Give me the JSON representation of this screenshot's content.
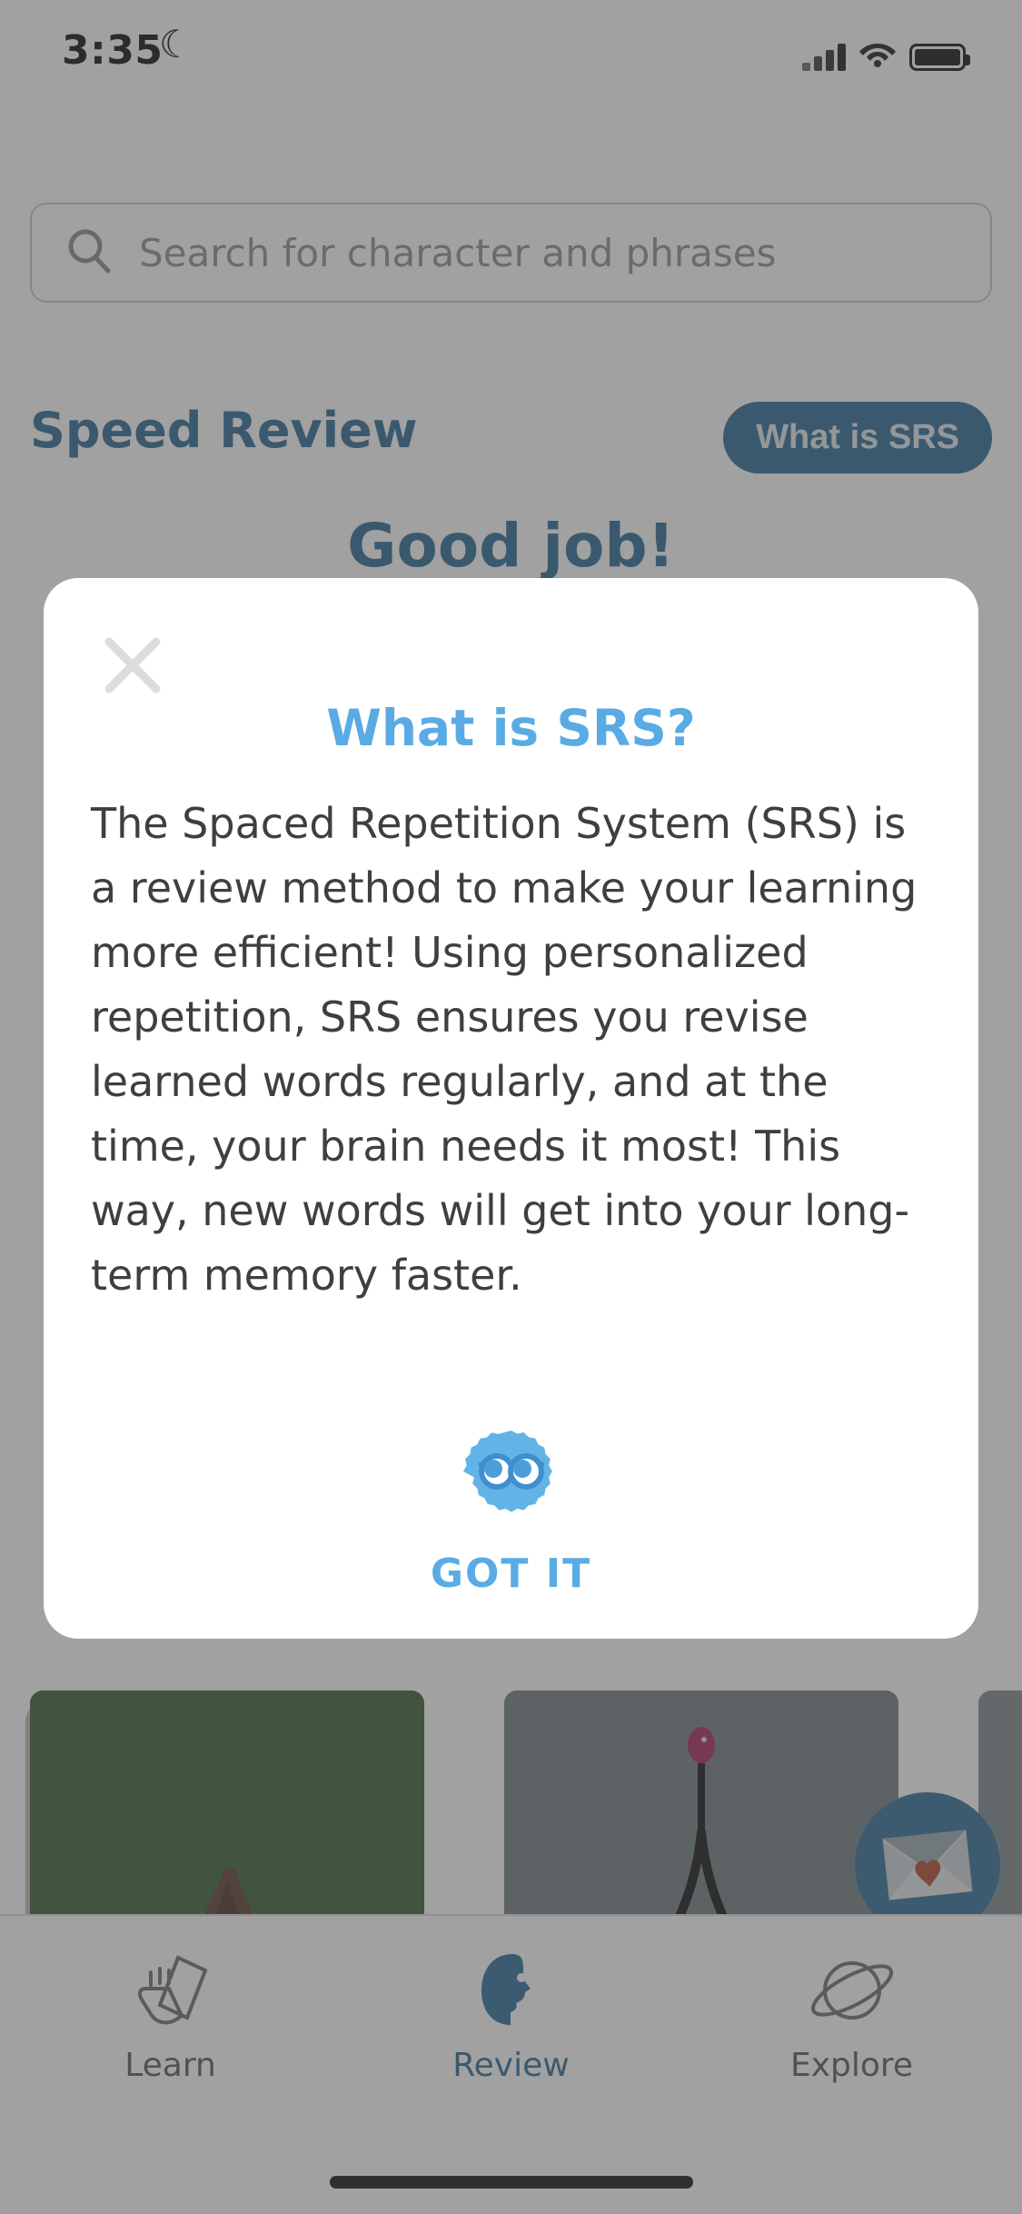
{
  "status_bar": {
    "time": "3:35",
    "dnd_icon": "crescent-moon-icon",
    "signal_icon": "cellular-signal-icon",
    "wifi_icon": "wifi-icon",
    "battery_icon": "battery-full-icon"
  },
  "search": {
    "icon": "search-icon",
    "placeholder": "Search for character and phrases",
    "value": ""
  },
  "header": {
    "title": "Speed Review",
    "srs_button": "What is SRS"
  },
  "content": {
    "headline": "Good job!",
    "fab_icon": "envelope-heart-icon",
    "cards": [
      {
        "name": "mountain-window-card",
        "color": "#3a5f2e"
      },
      {
        "name": "tower-card",
        "color": "#717e81"
      },
      {
        "name": "third-card",
        "color": "#7d8a8d"
      }
    ]
  },
  "modal": {
    "close_icon": "close-icon",
    "title": "What is SRS?",
    "body": "The Spaced Repetition System (SRS) is a review method to make your learning more efficient! Using personalized repetition, SRS ensures you revise learned words regularly, and at the time, your brain needs it most! This way, new words will get into your long-term memory faster.",
    "mascot_icon": "blue-mascot-glasses-icon",
    "cta_label": "GOT IT"
  },
  "tab_bar": {
    "tabs": [
      {
        "label": "Learn",
        "icon": "hand-cards-icon",
        "active": false
      },
      {
        "label": "Review",
        "icon": "head-profile-icon",
        "active": true
      },
      {
        "label": "Explore",
        "icon": "planet-icon",
        "active": false
      }
    ]
  },
  "colors": {
    "brand_blue": "#2b6a94",
    "light_blue": "#5aabe4",
    "text_dark": "#3f3f3f",
    "placeholder": "#8f8f8f"
  }
}
